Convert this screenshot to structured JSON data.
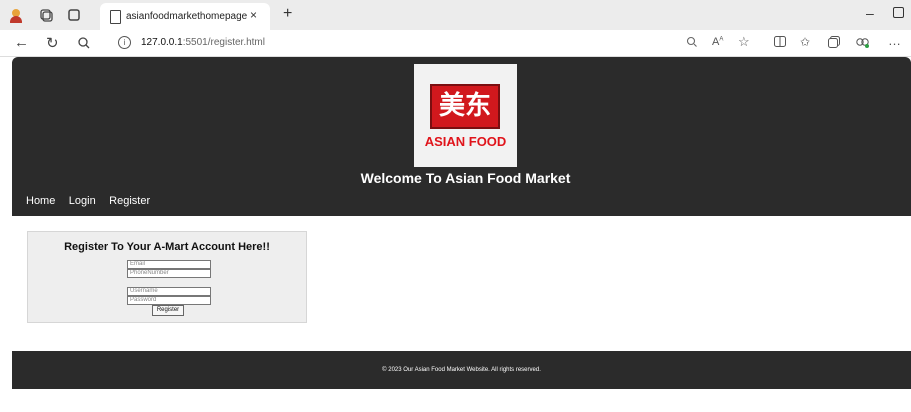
{
  "browser": {
    "tab_title": "asianfoodmarkethomepage",
    "tab_close": "×",
    "new_tab": "+",
    "url_host": "127.0.0.1",
    "url_rest": ":5501/register.html",
    "icons": [
      "avatar-icon",
      "workspaces-icon",
      "tab-actions-icon",
      "back-icon",
      "refresh-icon",
      "search-icon",
      "zoom-icon",
      "read-aloud-icon",
      "favorite-icon",
      "split-screen-icon",
      "favorites-icon",
      "collections-icon",
      "extensions-icon",
      "more-icon"
    ]
  },
  "site": {
    "logo_glyph": "美东",
    "logo_text": "ASIAN FOOD",
    "title": "Welcome To Asian Food Market",
    "nav": {
      "home": "Home",
      "login": "Login",
      "register": "Register"
    },
    "register_title": "Register To Your A-Mart Account Here!!",
    "fields": {
      "email_placeholder": "Email",
      "phone_placeholder": "PhoneNumber",
      "username_placeholder": "Username",
      "password_placeholder": "Password"
    },
    "register_button": "Register",
    "footer": "© 2023 Our Asian Food Market Website. All rights reserved."
  },
  "colors": {
    "header_bg": "#2b2b2b",
    "logo_red": "#d1181d",
    "card_bg": "#eeeeee"
  }
}
